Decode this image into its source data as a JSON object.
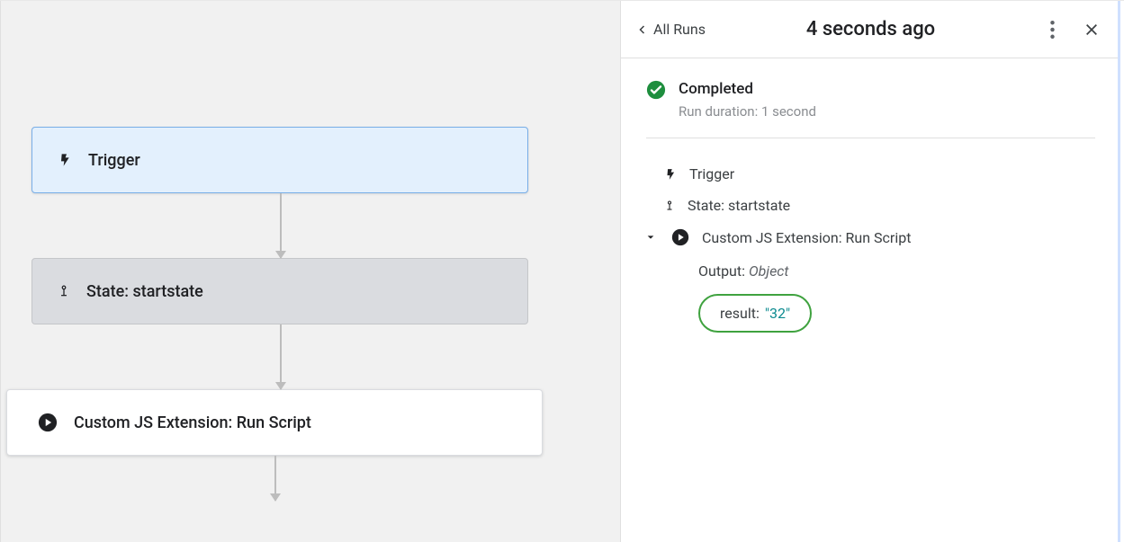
{
  "canvas": {
    "trigger_label": "Trigger",
    "state_label": "State: startstate",
    "action_label": "Custom JS Extension: Run Script"
  },
  "panel": {
    "back_label": "All Runs",
    "title": "4 seconds ago",
    "status": {
      "title": "Completed",
      "subtitle": "Run duration: 1 second"
    },
    "steps": {
      "trigger": "Trigger",
      "state": "State: startstate",
      "action": "Custom JS Extension: Run Script"
    },
    "output": {
      "label": "Output:",
      "type": "Object",
      "result_key": "result:",
      "result_value": "\"32\""
    }
  }
}
